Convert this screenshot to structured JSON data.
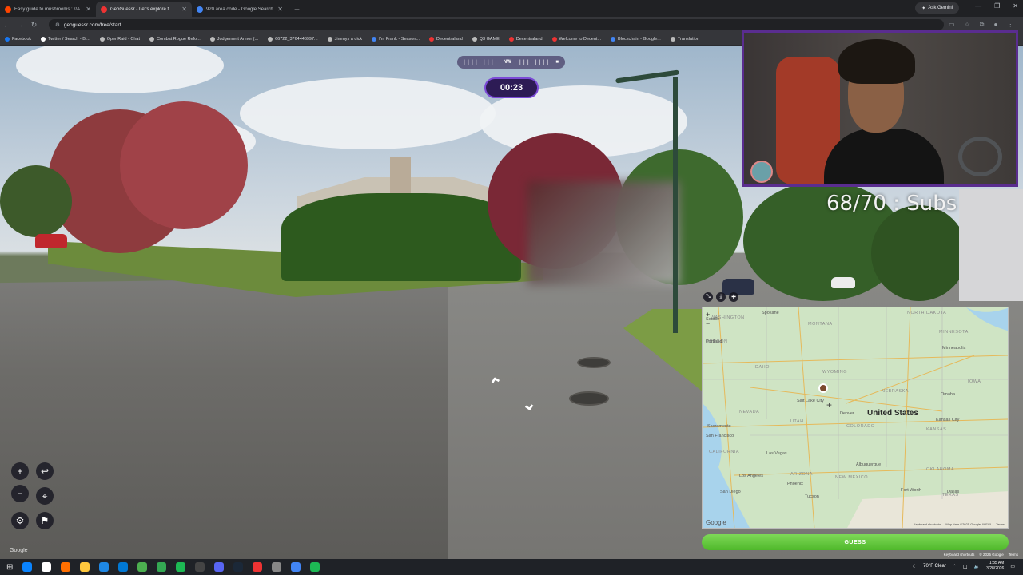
{
  "browser": {
    "tabs": [
      {
        "title": "Easy guide to mushrooms : r/A",
        "favicon_color": "#ff4500",
        "active": false
      },
      {
        "title": "GeoGuessr - Let's explore t",
        "favicon_color": "#e33",
        "active": true
      },
      {
        "title": "920 area code - Google Search",
        "favicon_color": "#4285f4",
        "active": false
      }
    ],
    "ask_gemini": "Ask Gemini",
    "url": "geoguessr.com/free/start",
    "bookmarks": [
      {
        "label": "Facebook",
        "color": "#1877f2"
      },
      {
        "label": "Twitter / Search - Bl...",
        "color": "#ffffff"
      },
      {
        "label": "OpenRaid - Chat",
        "color": "#bbbbbb"
      },
      {
        "label": "Combat Rogue Refo...",
        "color": "#bbbbbb"
      },
      {
        "label": "Judgement Armor (...",
        "color": "#bbbbbb"
      },
      {
        "label": "66722_3764446997...",
        "color": "#bbbbbb"
      },
      {
        "label": "Jimmys a dick",
        "color": "#bbbbbb"
      },
      {
        "label": "I'm Frank - Season...",
        "color": "#4285f4"
      },
      {
        "label": "Decentraland",
        "color": "#e33"
      },
      {
        "label": "Q3 GAME",
        "color": "#bbbbbb"
      },
      {
        "label": "Decentraland",
        "color": "#e33"
      },
      {
        "label": "Welcome to Decent...",
        "color": "#e33"
      },
      {
        "label": "Blockchain - Google...",
        "color": "#4285f4"
      },
      {
        "label": "Translation",
        "color": "#bbbbbb"
      }
    ]
  },
  "game": {
    "compass_label": "NW",
    "timer": "00:23",
    "streetview_watermark": "Google",
    "guess_label": "GUESS",
    "footer": [
      "Keyboard shortcuts",
      "© 2025 Google",
      "Terms"
    ]
  },
  "stream": {
    "subs_text": "68/70 : Subs"
  },
  "map": {
    "country_label": "United States",
    "states": [
      "WASHINGTON",
      "MONTANA",
      "NORTH DAKOTA",
      "MINNESOTA",
      "OREGON",
      "IDAHO",
      "WYOMING",
      "NEBRASKA",
      "NEVADA",
      "UTAH",
      "COLORADO",
      "KANSAS",
      "CALIFORNIA",
      "ARIZONA",
      "NEW MEXICO",
      "OKLAHOMA",
      "TEXAS",
      "IOWA"
    ],
    "cities": [
      "Spokane",
      "Portland",
      "Minneapolis",
      "Salt Lake City",
      "Denver",
      "Omaha",
      "Kansas City",
      "Sacramento",
      "San Francisco",
      "Las Vegas",
      "Albuquerque",
      "Los Angeles",
      "Phoenix",
      "San Diego",
      "Tucson",
      "Fort Worth",
      "Dallas",
      "Seattle"
    ],
    "google_logo": "Google",
    "footer": [
      "Keyboard shortcuts",
      "Map data ©2025 Google, INEGI",
      "Terms"
    ]
  },
  "taskbar": {
    "weather": "70°F  Clear",
    "time": "1:35 AM",
    "date": "3/28/2026",
    "icon_colors": [
      "#0a84ff",
      "#ffffff",
      "#ff6f00",
      "#ffc83d",
      "#1e88e5",
      "#0078d4",
      "#4caf50",
      "#34a853",
      "#1db954",
      "#444444",
      "#5865f2",
      "#1b2838",
      "#e33",
      "#888888",
      "#4285f4",
      "#1db954"
    ]
  }
}
